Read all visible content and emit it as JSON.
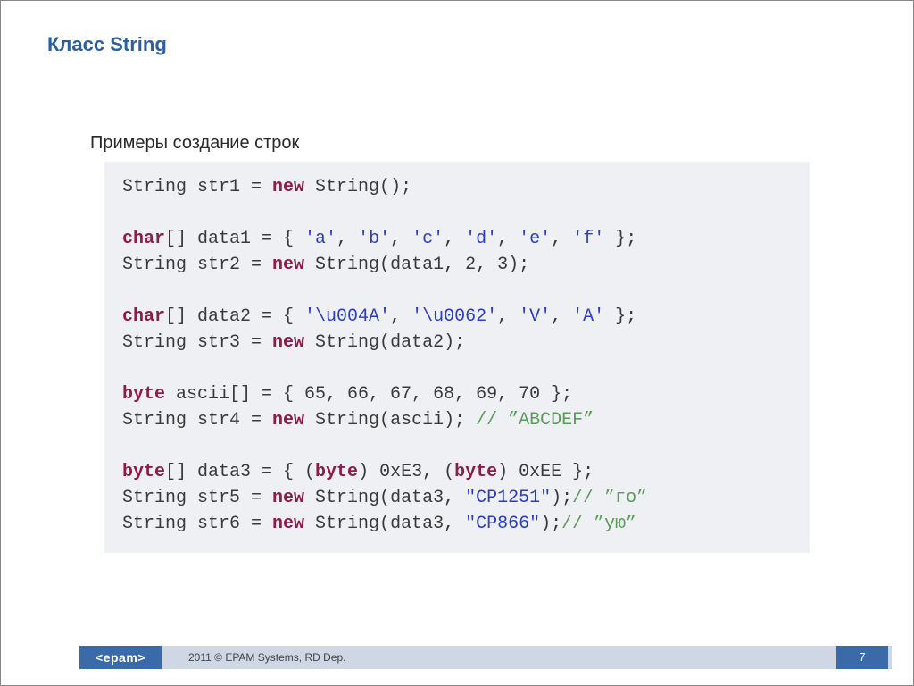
{
  "title": "Класс String",
  "subtitle": "Примеры создание строк",
  "code": {
    "l1a": "String str1 = ",
    "l1kw": "new",
    "l1b": " String();",
    "l3kw": "char",
    "l3a": "[] data1 = { ",
    "l3s": "'a'",
    "l3b": ", ",
    "l3s2": "'b'",
    "l3c": ", ",
    "l3s3": "'c'",
    "l3d": ", ",
    "l3s4": "'d'",
    "l3e": ", ",
    "l3s5": "'e'",
    "l3f": ", ",
    "l3s6": "'f'",
    "l3g": " };",
    "l4a": "String str2 = ",
    "l4kw": "new",
    "l4b": " String(data1, 2, 3);",
    "l6kw": "char",
    "l6a": "[] data2 = { ",
    "l6s1": "'\\u004A'",
    "l6b": ", ",
    "l6s2": "'\\u0062'",
    "l6c": ", ",
    "l6s3": "'V'",
    "l6d": ", ",
    "l6s4": "'A'",
    "l6e": " };",
    "l7a": "String str3 = ",
    "l7kw": "new",
    "l7b": " String(data2);",
    "l9kw": "byte",
    "l9a": " ascii[] = { 65, 66, 67, 68, 69, 70 };",
    "l10a": "String str4 = ",
    "l10kw": "new",
    "l10b": " String(ascii); ",
    "l10cmt": "// ”ABCDEF”",
    "l12kw": "byte",
    "l12a": "[] data3 = { (",
    "l12kw2": "byte",
    "l12b": ") 0xE3, (",
    "l12kw3": "byte",
    "l12c": ") 0xEE };",
    "l13a": "String str5 = ",
    "l13kw": "new",
    "l13b": " String(data3, ",
    "l13s": "\"CP1251\"",
    "l13c": ");",
    "l13cmt": "// ”го”",
    "l14a": "String str6 = ",
    "l14kw": "new",
    "l14b": " String(data3, ",
    "l14s": "\"CP866\"",
    "l14c": ");",
    "l14cmt": "// ”ую”"
  },
  "footer": {
    "logo": "<epam>",
    "text": "2011 © EPAM Systems, RD Dep.",
    "page": "7"
  }
}
